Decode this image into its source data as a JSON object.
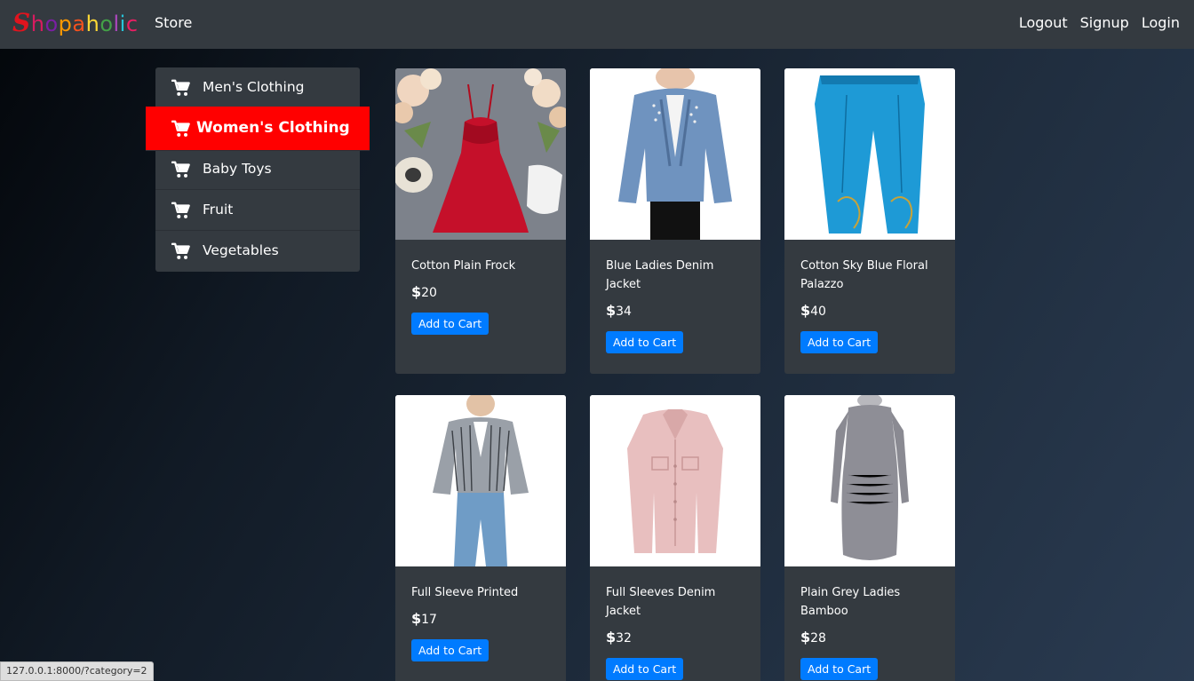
{
  "navbar": {
    "brand": "Shopaholic",
    "brand_letters": [
      "S",
      "h",
      "o",
      "p",
      "a",
      "h",
      "o",
      "l",
      "i",
      "c"
    ],
    "brand_colors": [
      "#e0141e",
      "#d81b60",
      "#7b1fa2",
      "#ff9800",
      "#f4511e",
      "#fdd835",
      "#43a047",
      "#ab47bc",
      "#26c6da",
      "#e91e63"
    ],
    "store_label": "Store",
    "links": [
      "Logout",
      "Signup",
      "Login"
    ]
  },
  "sidebar": {
    "active_color": "#ff0000",
    "items": [
      {
        "label": "Men's Clothing",
        "icon": "cart-icon",
        "active": false
      },
      {
        "label": "Women's Clothing",
        "icon": "cart-icon",
        "active": true
      },
      {
        "label": "Baby Toys",
        "icon": "cart-icon",
        "active": false
      },
      {
        "label": "Fruit",
        "icon": "cart-icon",
        "active": false
      },
      {
        "label": "Vegetables",
        "icon": "cart-icon",
        "active": false
      }
    ]
  },
  "products": [
    {
      "name": "Cotton Plain Frock",
      "price_symbol": "$",
      "price": "20",
      "button": "Add to Cart",
      "image": "red-dress"
    },
    {
      "name": "Blue Ladies Denim Jacket",
      "price_symbol": "$",
      "price": "34",
      "button": "Add to Cart",
      "image": "denim-jacket"
    },
    {
      "name": "Cotton Sky Blue Floral Palazzo",
      "price_symbol": "$",
      "price": "40",
      "button": "Add to Cart",
      "image": "blue-palazzo"
    },
    {
      "name": "Full Sleeve Printed",
      "price_symbol": "$",
      "price": "17",
      "button": "Add to Cart",
      "image": "striped-top"
    },
    {
      "name": "Full Sleeves Denim Jacket",
      "price_symbol": "$",
      "price": "32",
      "button": "Add to Cart",
      "image": "pink-jacket"
    },
    {
      "name": "Plain Grey Ladies Bamboo",
      "price_symbol": "$",
      "price": "28",
      "button": "Add to Cart",
      "image": "grey-dress"
    }
  ],
  "button_color": "#007bff",
  "status_bar": "127.0.0.1:8000/?category=2"
}
